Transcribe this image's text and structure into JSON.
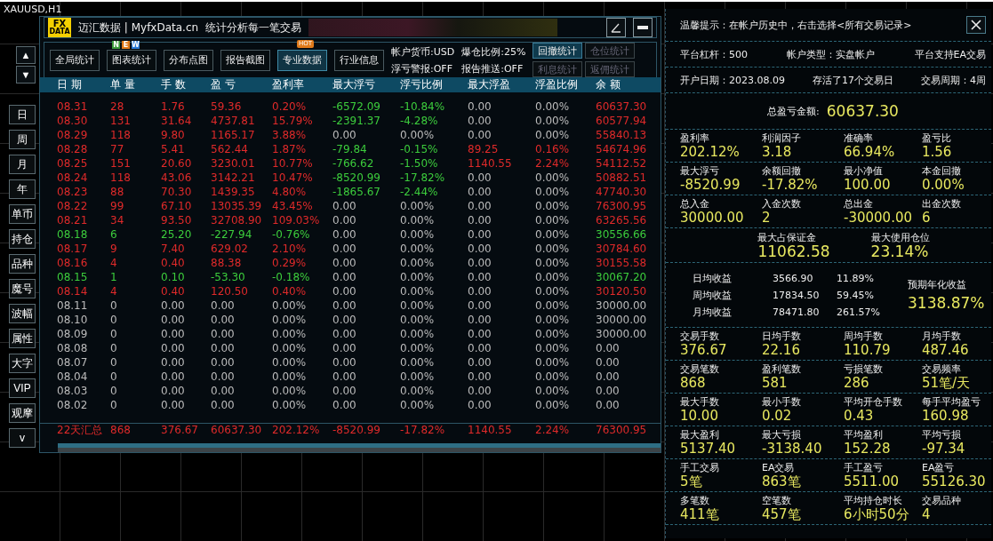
{
  "chart": {
    "symbol": "XAUUSD,H1"
  },
  "sidebar": {
    "arrows": [
      "▲",
      "▼"
    ],
    "items": [
      "日",
      "周",
      "月",
      "年",
      "单币",
      "持仓",
      "品种",
      "魔号",
      "波幅",
      "属性",
      "大字",
      "VIP",
      "观摩",
      "v"
    ]
  },
  "window": {
    "logo_top": "FX",
    "logo_bottom": "DATA",
    "title": "迈汇数据 | MyfxData.cn  统计分析每一笔交易"
  },
  "toolbar": {
    "tabs": [
      {
        "label": "全局统计",
        "selected": false
      },
      {
        "label": "图表统计",
        "selected": false,
        "badge_letters": [
          "N",
          "E",
          "W"
        ]
      },
      {
        "label": "分布点图",
        "selected": false
      },
      {
        "label": "报告截图",
        "selected": false
      },
      {
        "label": "专业数据",
        "selected": true,
        "badge_text": "HOT"
      },
      {
        "label": "行业信息",
        "selected": false
      }
    ],
    "settings": [
      "帐户货币:USD",
      "爆仓比例:25%",
      "浮亏警报:OFF",
      "报告推送:OFF"
    ],
    "stat_buttons": [
      {
        "label": "回撤统计",
        "disabled": false
      },
      {
        "label": "仓位统计",
        "disabled": true
      },
      {
        "label": "利息统计",
        "disabled": true
      },
      {
        "label": "返佣统计",
        "disabled": true
      }
    ]
  },
  "table": {
    "columns": [
      "日 期",
      "单 量",
      "手 数",
      "盈 亏",
      "盈利率",
      "最大浮亏",
      "浮亏比例",
      "最大浮盈",
      "浮盈比例",
      "余 额"
    ],
    "rows": [
      {
        "cells": [
          "08.31",
          "28",
          "1.76",
          "59.36",
          "0.20%",
          "-6572.09",
          "-10.84%",
          "0.00",
          "0.00%",
          "60637.30"
        ],
        "kind": "up",
        "float_loss": true,
        "float_profit": false
      },
      {
        "cells": [
          "08.30",
          "131",
          "31.64",
          "4737.81",
          "15.79%",
          "-2391.37",
          "-4.28%",
          "0.00",
          "0.00%",
          "60577.94"
        ],
        "kind": "up",
        "float_loss": true,
        "float_profit": false
      },
      {
        "cells": [
          "08.29",
          "118",
          "9.80",
          "1165.17",
          "3.88%",
          "0.00",
          "0.00%",
          "0.00",
          "0.00%",
          "55840.13"
        ],
        "kind": "up",
        "float_loss": false,
        "float_profit": false
      },
      {
        "cells": [
          "08.28",
          "77",
          "5.41",
          "562.44",
          "1.87%",
          "-79.84",
          "-0.15%",
          "89.25",
          "0.16%",
          "54674.96"
        ],
        "kind": "up",
        "float_loss": true,
        "float_profit": true
      },
      {
        "cells": [
          "08.25",
          "151",
          "20.60",
          "3230.01",
          "10.77%",
          "-766.62",
          "-1.50%",
          "1140.55",
          "2.24%",
          "54112.52"
        ],
        "kind": "up",
        "float_loss": true,
        "float_profit": true
      },
      {
        "cells": [
          "08.24",
          "118",
          "43.06",
          "3142.21",
          "10.47%",
          "-8520.99",
          "-17.82%",
          "0.00",
          "0.00%",
          "50882.51"
        ],
        "kind": "up",
        "float_loss": true,
        "float_profit": false
      },
      {
        "cells": [
          "08.23",
          "88",
          "70.30",
          "1439.35",
          "4.80%",
          "-1865.67",
          "-2.44%",
          "0.00",
          "0.00%",
          "47740.30"
        ],
        "kind": "up",
        "float_loss": true,
        "float_profit": false
      },
      {
        "cells": [
          "08.22",
          "99",
          "67.10",
          "13035.39",
          "43.45%",
          "0.00",
          "0.00%",
          "0.00",
          "0.00%",
          "76300.95"
        ],
        "kind": "up",
        "float_loss": false,
        "float_profit": false
      },
      {
        "cells": [
          "08.21",
          "34",
          "93.50",
          "32708.90",
          "109.03%",
          "0.00",
          "0.00%",
          "0.00",
          "0.00%",
          "63265.56"
        ],
        "kind": "up",
        "float_loss": false,
        "float_profit": false
      },
      {
        "cells": [
          "08.18",
          "6",
          "25.20",
          "-227.94",
          "-0.76%",
          "0.00",
          "0.00%",
          "0.00",
          "0.00%",
          "30556.66"
        ],
        "kind": "down",
        "float_loss": false,
        "float_profit": false
      },
      {
        "cells": [
          "08.17",
          "9",
          "7.40",
          "629.02",
          "2.10%",
          "0.00",
          "0.00%",
          "0.00",
          "0.00%",
          "30784.60"
        ],
        "kind": "up",
        "float_loss": false,
        "float_profit": false
      },
      {
        "cells": [
          "08.16",
          "4",
          "0.40",
          "88.38",
          "0.29%",
          "0.00",
          "0.00%",
          "0.00",
          "0.00%",
          "30155.58"
        ],
        "kind": "up",
        "float_loss": false,
        "float_profit": false
      },
      {
        "cells": [
          "08.15",
          "1",
          "0.10",
          "-53.30",
          "-0.18%",
          "0.00",
          "0.00%",
          "0.00",
          "0.00%",
          "30067.20"
        ],
        "kind": "down",
        "float_loss": false,
        "float_profit": false
      },
      {
        "cells": [
          "08.14",
          "4",
          "0.40",
          "120.50",
          "0.40%",
          "0.00",
          "0.00%",
          "0.00",
          "0.00%",
          "30120.50"
        ],
        "kind": "up",
        "float_loss": false,
        "float_profit": false
      },
      {
        "cells": [
          "08.11",
          "0",
          "0.00",
          "0.00",
          "0.00%",
          "0.00",
          "0.00%",
          "0.00",
          "0.00%",
          "30000.00"
        ],
        "kind": "flat",
        "float_loss": false,
        "float_profit": false
      },
      {
        "cells": [
          "08.10",
          "0",
          "0.00",
          "0.00",
          "0.00%",
          "0.00",
          "0.00%",
          "0.00",
          "0.00%",
          "30000.00"
        ],
        "kind": "flat",
        "float_loss": false,
        "float_profit": false
      },
      {
        "cells": [
          "08.09",
          "0",
          "0.00",
          "0.00",
          "0.00%",
          "0.00",
          "0.00%",
          "0.00",
          "0.00%",
          "30000.00"
        ],
        "kind": "flat",
        "float_loss": false,
        "float_profit": false
      },
      {
        "cells": [
          "08.08",
          "0",
          "0.00",
          "0.00",
          "0.00%",
          "0.00",
          "0.00%",
          "0.00",
          "0.00%",
          "0.00"
        ],
        "kind": "flat",
        "float_loss": false,
        "float_profit": false
      },
      {
        "cells": [
          "08.07",
          "0",
          "0.00",
          "0.00",
          "0.00%",
          "0.00",
          "0.00%",
          "0.00",
          "0.00%",
          "0.00"
        ],
        "kind": "flat",
        "float_loss": false,
        "float_profit": false
      },
      {
        "cells": [
          "08.04",
          "0",
          "0.00",
          "0.00",
          "0.00%",
          "0.00",
          "0.00%",
          "0.00",
          "0.00%",
          "0.00"
        ],
        "kind": "flat",
        "float_loss": false,
        "float_profit": false
      },
      {
        "cells": [
          "08.03",
          "0",
          "0.00",
          "0.00",
          "0.00%",
          "0.00",
          "0.00%",
          "0.00",
          "0.00%",
          "0.00"
        ],
        "kind": "flat",
        "float_loss": false,
        "float_profit": false
      },
      {
        "cells": [
          "08.02",
          "0",
          "0.00",
          "0.00",
          "0.00%",
          "0.00",
          "0.00%",
          "0.00",
          "0.00%",
          "0.00"
        ],
        "kind": "flat",
        "float_loss": false,
        "float_profit": false
      }
    ],
    "summary": [
      "22天汇总",
      "868",
      "376.67",
      "60637.30",
      "202.12%",
      "-8520.99",
      "-17.82%",
      "1140.55",
      "2.24%",
      "76300.95"
    ]
  },
  "stats_panel": {
    "hint": "温馨提示：在帐户历史中，右击选择<所有交易记录>",
    "info_rows": [
      [
        "平台杠杆：500",
        "帐户类型：实盘帐户",
        "平台支持EA交易"
      ],
      [
        "开户日期：2023.08.09",
        "存活了17个交易日",
        "交易周期：4周"
      ]
    ],
    "total": {
      "label": "总盈亏金额:",
      "value": "60637.30"
    },
    "sections": [
      {
        "kind": "quad",
        "items": [
          {
            "label": "盈利率",
            "value": "202.12%"
          },
          {
            "label": "利润因子",
            "value": "3.18"
          },
          {
            "label": "准确率",
            "value": "66.94%"
          },
          {
            "label": "盈亏比",
            "value": "1.56"
          }
        ]
      },
      {
        "kind": "quad",
        "items": [
          {
            "label": "最大浮亏",
            "value": "-8520.99"
          },
          {
            "label": "余额回撤",
            "value": "-17.82%"
          },
          {
            "label": "最小净值",
            "value": "100.00"
          },
          {
            "label": "本金回撤",
            "value": "0.00%"
          }
        ]
      },
      {
        "kind": "quad",
        "items": [
          {
            "label": "总入金",
            "value": "30000.00"
          },
          {
            "label": "入金次数",
            "value": "2"
          },
          {
            "label": "总出金",
            "value": "-30000.00"
          },
          {
            "label": "出金次数",
            "value": "6"
          }
        ]
      },
      {
        "kind": "pair",
        "items": [
          {
            "label": "最大占保证金",
            "value": "11062.58"
          },
          {
            "label": "最大使用仓位",
            "value": "23.14%"
          }
        ]
      },
      {
        "kind": "average",
        "rows": [
          {
            "label": "日均收益",
            "amount": "3566.90",
            "pct": "11.89%"
          },
          {
            "label": "周均收益",
            "amount": "17834.50",
            "pct": "59.45%"
          },
          {
            "label": "月均收益",
            "amount": "78471.80",
            "pct": "261.57%"
          }
        ],
        "side": {
          "label": "预期年化收益",
          "value": "3138.87%"
        }
      },
      {
        "kind": "quad",
        "items": [
          {
            "label": "交易手数",
            "value": "376.67"
          },
          {
            "label": "日均手数",
            "value": "22.16"
          },
          {
            "label": "周均手数",
            "value": "110.79"
          },
          {
            "label": "月均手数",
            "value": "487.46"
          }
        ]
      },
      {
        "kind": "quad",
        "items": [
          {
            "label": "交易笔数",
            "value": "868"
          },
          {
            "label": "盈利笔数",
            "value": "581"
          },
          {
            "label": "亏损笔数",
            "value": "286"
          },
          {
            "label": "交易频率",
            "value": "51笔/天"
          }
        ]
      },
      {
        "kind": "quad",
        "items": [
          {
            "label": "最大手数",
            "value": "10.00"
          },
          {
            "label": "最小手数",
            "value": "0.02"
          },
          {
            "label": "平均开仓手数",
            "value": "0.43"
          },
          {
            "label": "每手平均盈亏",
            "value": "160.98"
          }
        ]
      },
      {
        "kind": "quad",
        "items": [
          {
            "label": "最大盈利",
            "value": "5137.40"
          },
          {
            "label": "最大亏损",
            "value": "-3138.40"
          },
          {
            "label": "平均盈利",
            "value": "152.28"
          },
          {
            "label": "平均亏损",
            "value": "-97.34"
          }
        ]
      },
      {
        "kind": "quad",
        "items": [
          {
            "label": "手工交易",
            "value": "5笔"
          },
          {
            "label": "EA交易",
            "value": "863笔"
          },
          {
            "label": "手工盈亏",
            "value": "5511.00"
          },
          {
            "label": "EA盈亏",
            "value": "55126.30"
          }
        ]
      },
      {
        "kind": "quad",
        "items": [
          {
            "label": "多笔数",
            "value": "411笔"
          },
          {
            "label": "空笔数",
            "value": "457笔"
          },
          {
            "label": "平均持仓时长",
            "value": "6小时50分"
          },
          {
            "label": "交易品种",
            "value": "4"
          }
        ]
      }
    ]
  }
}
